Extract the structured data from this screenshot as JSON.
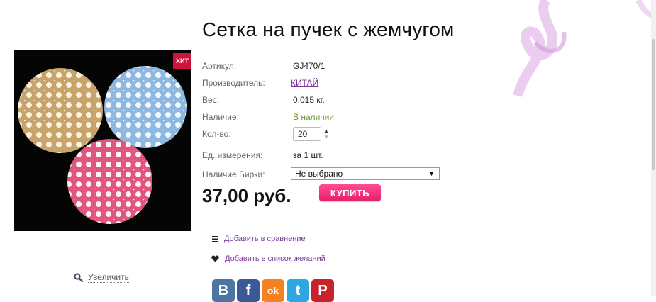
{
  "product": {
    "title": "Сетка на пучек с жемчугом",
    "badge": "ХИТ",
    "zoom_label": "Увеличить"
  },
  "specs": {
    "article_label": "Артикул:",
    "article_value": "GJ470/1",
    "maker_label": "Производитель:",
    "maker_value": "КИТАЙ",
    "weight_label": "Вес:",
    "weight_value": "0,015 кг.",
    "stock_label": "Наличие:",
    "stock_value": "В наличии",
    "qty_label": "Кол-во:",
    "qty_value": "20",
    "unit_label": "Ед. измерения:",
    "unit_value": "за 1 шт.",
    "tag_label": "Наличие Бирки:",
    "tag_selected": "Не выбрано"
  },
  "purchase": {
    "price": "37,00 руб.",
    "buy_label": "КУПИТЬ"
  },
  "actions": {
    "compare_label": "Добавить в сравнение",
    "wishlist_label": "Добавить в список желаний"
  },
  "social": [
    {
      "name": "vk",
      "glyph": "B",
      "color": "#4c75a3"
    },
    {
      "name": "facebook",
      "glyph": "f",
      "color": "#3b5998"
    },
    {
      "name": "odnoklassniki",
      "glyph": "ok",
      "color": "#f58220"
    },
    {
      "name": "twitter",
      "glyph": "t",
      "color": "#2ea7e0"
    },
    {
      "name": "pinterest",
      "glyph": "P",
      "color": "#c8232c"
    }
  ],
  "colors": {
    "accent": "#e3206b",
    "link": "#7b3a9c",
    "in_stock": "#6a9a2a",
    "badge": "#d0123e"
  }
}
